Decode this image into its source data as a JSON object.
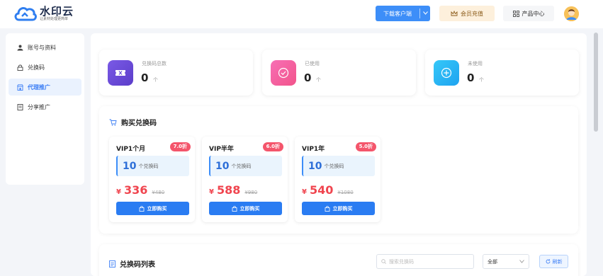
{
  "app": {
    "name": "水印云",
    "slogan": "让素材处理更简单"
  },
  "header": {
    "download_label": "下载客户端",
    "vip_label": "会员充值",
    "products_label": "产品中心"
  },
  "sidebar": {
    "items": [
      {
        "label": "账号与资料",
        "icon": "user-icon",
        "active": false
      },
      {
        "label": "兑换码",
        "icon": "lock-icon",
        "active": false
      },
      {
        "label": "代理推广",
        "icon": "shop-icon",
        "active": true
      },
      {
        "label": "分享推广",
        "icon": "document-icon",
        "active": false
      }
    ]
  },
  "stats": [
    {
      "label": "兑换码总数",
      "value": "0",
      "unit": "个",
      "icon": "ticket-icon",
      "color": "#6a4fd8"
    },
    {
      "label": "已使用",
      "value": "0",
      "unit": "个",
      "icon": "check-circle-icon",
      "color": "#f35fa0"
    },
    {
      "label": "未使用",
      "value": "0",
      "unit": "个",
      "icon": "plus-circle-icon",
      "color": "#27b5f5"
    }
  ],
  "purchase": {
    "title": "购买兑换码",
    "packages": [
      {
        "name": "VIP1个月",
        "discount": "7.0折",
        "count": "10",
        "count_unit": "个兑换码",
        "currency": "¥",
        "price": "336",
        "original": "¥480",
        "button": "立即购买"
      },
      {
        "name": "VIP半年",
        "discount": "6.0折",
        "count": "10",
        "count_unit": "个兑换码",
        "currency": "¥",
        "price": "588",
        "original": "¥980",
        "button": "立即购买"
      },
      {
        "name": "VIP1年",
        "discount": "5.0折",
        "count": "10",
        "count_unit": "个兑换码",
        "currency": "¥",
        "price": "540",
        "original": "¥1080",
        "button": "立即购买"
      }
    ]
  },
  "list": {
    "title": "兑换码列表",
    "search_placeholder": "搜索兑换码",
    "filter_value": "全部",
    "refresh_label": "刷新"
  }
}
